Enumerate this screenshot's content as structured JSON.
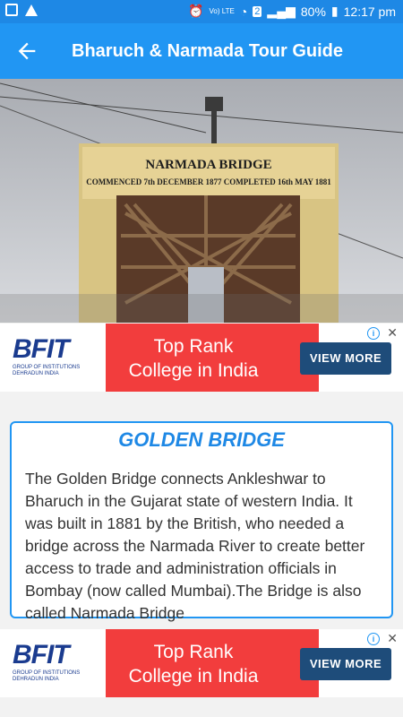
{
  "status_bar": {
    "battery": "80%",
    "time": "12:17 pm",
    "network": "Vo) LTE",
    "sim": "2"
  },
  "app_bar": {
    "title": "Bharuch & Narmada Tour Guide"
  },
  "hero": {
    "sign_title": "NARMADA BRIDGE",
    "sign_text": "COMMENCED 7th DECEMBER 1877 COMPLETED 16th MAY 1881"
  },
  "ads": [
    {
      "brand": "BFIT",
      "brand_sub": "GROUP OF INSTITUTIONS DEHRADUN INDIA",
      "headline": "Top Rank College in India",
      "cta": "VIEW MORE"
    },
    {
      "brand": "BFIT",
      "brand_sub": "GROUP OF INSTITUTIONS DEHRADUN INDIA",
      "headline": "Top Rank College in India",
      "cta": "VIEW MORE"
    }
  ],
  "card": {
    "heading": "GOLDEN BRIDGE",
    "description": "The Golden Bridge connects Ankleshwar to Bharuch in the Gujarat state of western India. It was built in 1881 by the British, who needed a bridge across the Narmada River to create better access to trade and administration officials in Bombay (now called Mumbai).The Bridge is also called Narmada Bridge"
  },
  "colors": {
    "primary": "#2196f3",
    "status_bar": "#1e88e5",
    "ad_red": "#f23d3d",
    "ad_button": "#1e4c7a"
  }
}
